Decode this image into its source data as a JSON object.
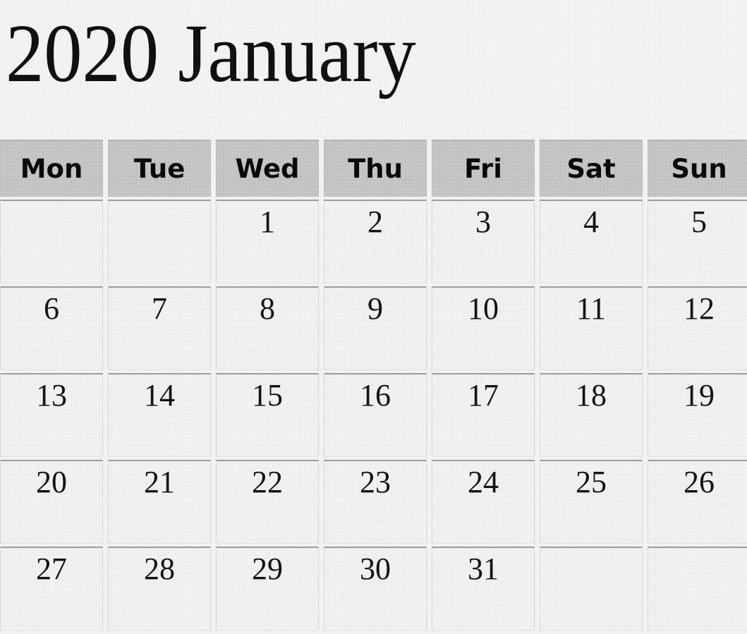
{
  "title": "2020 January",
  "year": "2020",
  "month": "January",
  "colors": {
    "page_background": "#f0f0f0",
    "header_cell_background": "#c3c3c3",
    "day_cell_background": "#eeeeee",
    "text": "#131313",
    "cell_top_border": "#9d9d9d"
  },
  "weekdays": [
    {
      "label": "Mon"
    },
    {
      "label": "Tue"
    },
    {
      "label": "Wed"
    },
    {
      "label": "Thu"
    },
    {
      "label": "Fri"
    },
    {
      "label": "Sat"
    },
    {
      "label": "Sun"
    }
  ],
  "weeks": [
    [
      {
        "day": ""
      },
      {
        "day": ""
      },
      {
        "day": "1"
      },
      {
        "day": "2"
      },
      {
        "day": "3"
      },
      {
        "day": "4"
      },
      {
        "day": "5"
      }
    ],
    [
      {
        "day": "6"
      },
      {
        "day": "7"
      },
      {
        "day": "8"
      },
      {
        "day": "9"
      },
      {
        "day": "10"
      },
      {
        "day": "11"
      },
      {
        "day": "12"
      }
    ],
    [
      {
        "day": "13"
      },
      {
        "day": "14"
      },
      {
        "day": "15"
      },
      {
        "day": "16"
      },
      {
        "day": "17"
      },
      {
        "day": "18"
      },
      {
        "day": "19"
      }
    ],
    [
      {
        "day": "20"
      },
      {
        "day": "21"
      },
      {
        "day": "22"
      },
      {
        "day": "23"
      },
      {
        "day": "24"
      },
      {
        "day": "25"
      },
      {
        "day": "26"
      }
    ],
    [
      {
        "day": "27"
      },
      {
        "day": "28"
      },
      {
        "day": "29"
      },
      {
        "day": "30"
      },
      {
        "day": "31"
      },
      {
        "day": ""
      },
      {
        "day": ""
      }
    ]
  ]
}
